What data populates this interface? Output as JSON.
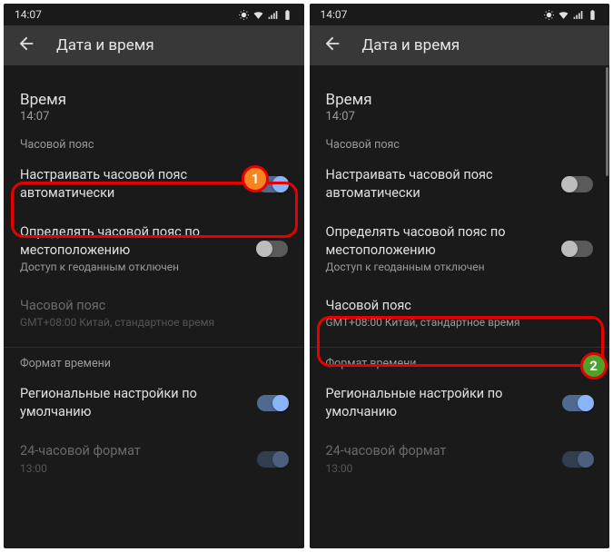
{
  "status_time": "14:07",
  "app_title": "Дата и время",
  "clock": {
    "label": "Время",
    "value": "14:07"
  },
  "tz_section_label": "Часовой пояс",
  "auto_tz_label": "Настраивать часовой пояс автоматически",
  "loc_tz_label": "Определять часовой пояс по местоположению",
  "loc_tz_sub": "Доступ к геоданным отключен",
  "tz_row_label": "Часовой пояс",
  "tz_row_sub": "GMT+08:00 Китай, стандартное время",
  "fmt_section_label": "Формат времени",
  "regional_label": "Региональные настройки по умолчанию",
  "h24_label": "24-часовой формат",
  "h24_sub": "13:00",
  "badge1": "1",
  "badge2": "2"
}
